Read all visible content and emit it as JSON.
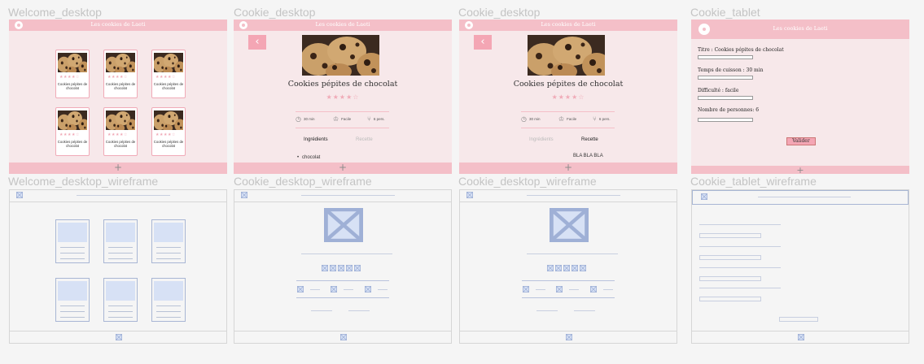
{
  "frames": {
    "welcome_desktop": "Welcome_desktop",
    "cookie_desktop_1": "Cookie_desktop",
    "cookie_desktop_2": "Cookie_desktop",
    "cookie_tablet": "Cookie_tablet",
    "welcome_wireframe": "Welcome_desktop_wireframe",
    "cookie_desktop_wireframe_1": "Cookie_desktop_wireframe",
    "cookie_desktop_wireframe_2": "Cookie_desktop_wireframe",
    "cookie_tablet_wireframe": "Cookie_tablet_wireframe"
  },
  "site": {
    "header_title": "Les cookies de Laeti",
    "footer_plus": "+"
  },
  "welcome": {
    "cards": [
      {
        "name": "Cookies pépites de chocolat",
        "rating": 4
      },
      {
        "name": "Cookies pépites de chocolat",
        "rating": 4
      },
      {
        "name": "Cookies pépites de chocolat",
        "rating": 4
      },
      {
        "name": "Cookies pépites de chocolat",
        "rating": 4
      },
      {
        "name": "Cookies pépites de chocolat",
        "rating": 4
      },
      {
        "name": "Cookies pépites de chocolat",
        "rating": 4
      }
    ]
  },
  "recipe": {
    "back_icon": "chevron-left-icon",
    "title": "Cookies pépites de chocolat",
    "rating": 4,
    "stars": "★★★★☆",
    "time": "30 min",
    "difficulty": "Facile",
    "persons": "6 pers.",
    "tab_ingredients": "Ingrédients",
    "tab_recipe": "Recette",
    "ingredient_bullet": "•",
    "ingredient_1": "chocolat",
    "recipe_text": "BLA BLA BLA"
  },
  "tablet_form": {
    "title_label": "Titre : Cookies pépites de chocolat",
    "time_label": "Temps de cuisson : 30 min",
    "difficulty_label": "Difficulté : facile",
    "persons_label": "Nombre de personnes: 6",
    "submit_label": "Valider"
  },
  "colors": {
    "header_pink": "#f4bfc8",
    "page_pink": "#f7e8ea",
    "wire_blue": "#d7e1f5"
  }
}
